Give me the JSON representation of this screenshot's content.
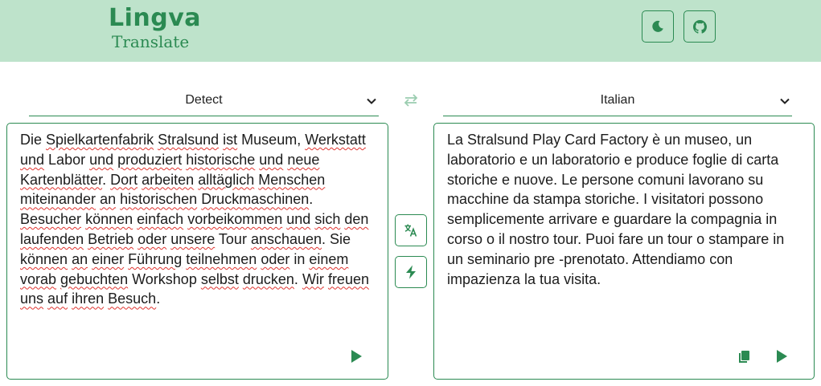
{
  "header": {
    "logo_word": "Lingva",
    "logo_sub": "Translate",
    "theme_button_icon": "moon-icon",
    "github_button_icon": "github-icon",
    "brand_color": "#2b8a52",
    "header_bg": "#bee3cb"
  },
  "source_select": {
    "value": "Detect"
  },
  "target_select": {
    "value": "Italian"
  },
  "swap_icon": "swap-arrows-icon",
  "source_text": {
    "segments": [
      [
        "Die ",
        false
      ],
      [
        "Spielkartenfabrik",
        true
      ],
      [
        " ",
        false
      ],
      [
        "Stralsund",
        true
      ],
      [
        " ",
        false
      ],
      [
        "ist",
        true
      ],
      [
        " Museum, ",
        false
      ],
      [
        "Werkstatt",
        true
      ],
      [
        " ",
        false
      ],
      [
        "und",
        true
      ],
      [
        " Labor ",
        false
      ],
      [
        "und",
        true
      ],
      [
        " ",
        false
      ],
      [
        "produziert",
        true
      ],
      [
        " ",
        false
      ],
      [
        "historische",
        true
      ],
      [
        " ",
        false
      ],
      [
        "und",
        true
      ],
      [
        " ",
        false
      ],
      [
        "neue",
        true
      ],
      [
        " ",
        false
      ],
      [
        "Kartenblätter",
        true
      ],
      [
        ". ",
        false
      ],
      [
        "Dort",
        true
      ],
      [
        " ",
        false
      ],
      [
        "arbeiten",
        true
      ],
      [
        " ",
        false
      ],
      [
        "alltäglich",
        true
      ],
      [
        " ",
        false
      ],
      [
        "Menschen",
        true
      ],
      [
        " ",
        false
      ],
      [
        "miteinander",
        true
      ],
      [
        " ",
        false
      ],
      [
        "an",
        true
      ],
      [
        " ",
        false
      ],
      [
        "historischen",
        true
      ],
      [
        " ",
        false
      ],
      [
        "Druckmaschinen",
        true
      ],
      [
        ". ",
        false
      ],
      [
        "Besucher",
        true
      ],
      [
        " ",
        false
      ],
      [
        "können",
        true
      ],
      [
        " ",
        false
      ],
      [
        "einfach",
        true
      ],
      [
        " ",
        false
      ],
      [
        "vorbeikommen",
        true
      ],
      [
        " ",
        false
      ],
      [
        "und",
        true
      ],
      [
        " ",
        false
      ],
      [
        "sich",
        true
      ],
      [
        " ",
        false
      ],
      [
        "den",
        true
      ],
      [
        " ",
        false
      ],
      [
        "laufenden",
        true
      ],
      [
        " ",
        false
      ],
      [
        "Betrieb",
        true
      ],
      [
        " ",
        false
      ],
      [
        "oder",
        true
      ],
      [
        " ",
        false
      ],
      [
        "unsere",
        true
      ],
      [
        " Tour ",
        false
      ],
      [
        "anschauen",
        true
      ],
      [
        ". Sie ",
        false
      ],
      [
        "können",
        true
      ],
      [
        " ",
        false
      ],
      [
        "an",
        true
      ],
      [
        " ",
        false
      ],
      [
        "einer",
        true
      ],
      [
        " ",
        false
      ],
      [
        "Führung",
        true
      ],
      [
        " ",
        false
      ],
      [
        "teilnehmen",
        true
      ],
      [
        " ",
        false
      ],
      [
        "oder",
        true
      ],
      [
        " in ",
        false
      ],
      [
        "einem",
        true
      ],
      [
        " ",
        false
      ],
      [
        "vorab",
        true
      ],
      [
        " ",
        false
      ],
      [
        "gebuchten",
        true
      ],
      [
        " Workshop ",
        false
      ],
      [
        "selbst",
        true
      ],
      [
        " ",
        false
      ],
      [
        "drucken",
        true
      ],
      [
        ". ",
        false
      ],
      [
        "Wir",
        true
      ],
      [
        " ",
        false
      ],
      [
        "freuen",
        true
      ],
      [
        " ",
        false
      ],
      [
        "uns",
        true
      ],
      [
        " ",
        false
      ],
      [
        "auf",
        true
      ],
      [
        " ",
        false
      ],
      [
        "ihren",
        true
      ],
      [
        " ",
        false
      ],
      [
        "Besuch",
        true
      ],
      [
        ".",
        false
      ]
    ]
  },
  "target_text": "La Stralsund Play Card Factory è un museo, un laboratorio e un laboratorio e produce foglie di carta storiche e nuove. Le persone comuni lavorano su macchine da stampa storiche. I visitatori possono semplicemente arrivare e guardare la compagnia in corso o il nostro tour. Puoi fare un tour o stampare in un seminario pre -prenotato. Attendiamo con impazienza la tua visita.",
  "buttons": {
    "translate_icon": "translate-icon",
    "auto_icon": "lightning-icon",
    "copy_icon": "copy-icon",
    "play_icon": "play-icon"
  }
}
